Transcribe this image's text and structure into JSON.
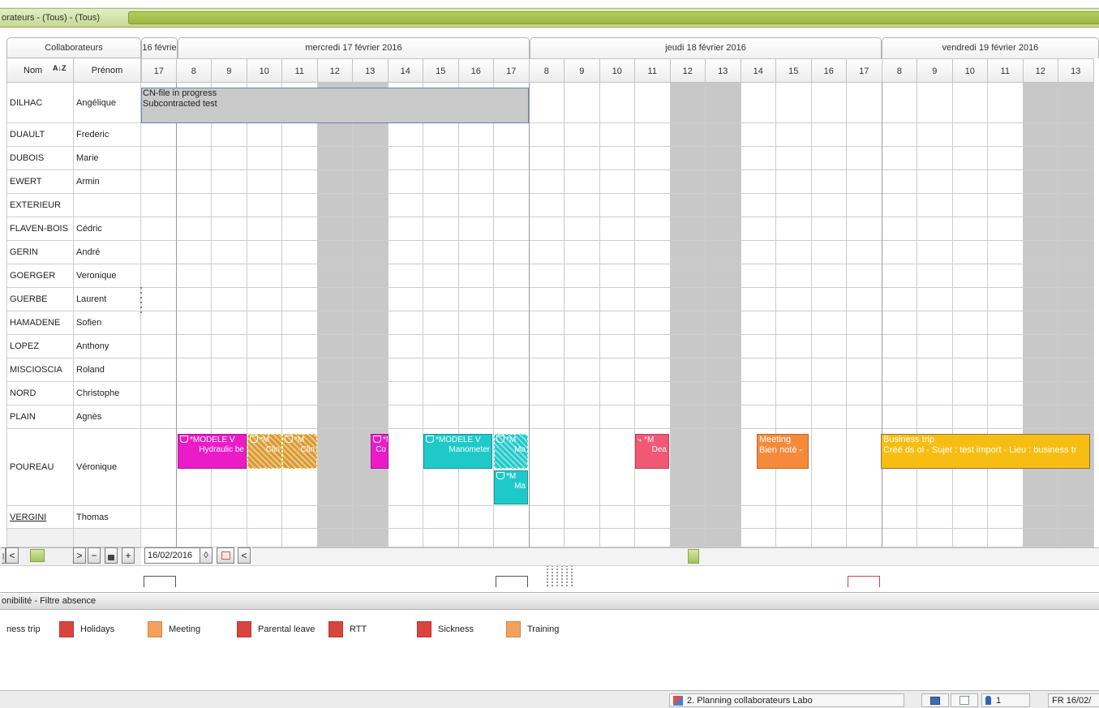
{
  "window": {
    "title": "orateurs - (Tous) - (Tous)"
  },
  "header": {
    "collaborateurs": "Collaborateurs",
    "nom": "Nom",
    "prenom": "Prénom",
    "sort_glyph": "A↓Z",
    "days": [
      "16 févrie",
      "mercredi 17 février 2016",
      "jeudi 18 février 2016",
      "vendredi 19 février 2016"
    ],
    "hours_prev": [
      "17"
    ],
    "hours_wed": [
      "8",
      "9",
      "10",
      "11",
      "12",
      "13",
      "14",
      "15",
      "16",
      "17"
    ],
    "hours_thu": [
      "8",
      "9",
      "10",
      "11",
      "12",
      "13",
      "14",
      "15",
      "16",
      "17"
    ],
    "hours_fri": [
      "8",
      "9",
      "10",
      "11",
      "12",
      "13"
    ]
  },
  "rows": [
    {
      "nom": "DILHAC",
      "prenom": "Angélique"
    },
    {
      "nom": "DUAULT",
      "prenom": "Frederic"
    },
    {
      "nom": "DUBOIS",
      "prenom": "Marie"
    },
    {
      "nom": "EWERT",
      "prenom": "Armin"
    },
    {
      "nom": "EXTERIEUR",
      "prenom": ""
    },
    {
      "nom": "FLAVEN-BOIS",
      "prenom": "Cédric"
    },
    {
      "nom": "GERIN",
      "prenom": "André"
    },
    {
      "nom": "GOERGER",
      "prenom": "Veronique"
    },
    {
      "nom": "GUERBE",
      "prenom": "Laurent"
    },
    {
      "nom": "HAMADENE",
      "prenom": "Sofien"
    },
    {
      "nom": "LOPEZ",
      "prenom": "Anthony"
    },
    {
      "nom": "MISCIOSCIA",
      "prenom": "Roland"
    },
    {
      "nom": "NORD",
      "prenom": "Christophe"
    },
    {
      "nom": "PLAIN",
      "prenom": "Agnès"
    },
    {
      "nom": "POUREAU",
      "prenom": "Véronique"
    },
    {
      "nom": "VERGINI",
      "prenom": "Thomas"
    }
  ],
  "events": {
    "dilhac": {
      "line1": "CN-file in progress",
      "line2": "Subcontracted test"
    },
    "p1": {
      "line1": "*MODELE V",
      "line2": "Hydraulic be"
    },
    "p2": {
      "line1": "*M",
      "line2": "Clin"
    },
    "p3": {
      "line1": "*M",
      "line2": "Clin"
    },
    "p4": {
      "line1": "*M",
      "line2": "Co"
    },
    "p5": {
      "line1": "*MODELE V",
      "line2": "Manometer"
    },
    "p6": {
      "line1": "*M",
      "line2": "Ma"
    },
    "p7": {
      "line1": "*M",
      "line2": "Ma"
    },
    "p8": {
      "line1": "*M",
      "line2": "Dea"
    },
    "p9": {
      "line1": "Meeting",
      "line2": "Bien noté -"
    },
    "p10": {
      "line1": "Business trip",
      "line2": "Créé ds ol - Sujet : test import - Lieu : business tr"
    }
  },
  "navigator": {
    "date": "16/02/2016",
    "spinner_glyph": "◊",
    "prev_glyph": "<",
    "next_glyph": ">",
    "minus_glyph": "−",
    "plus_glyph": "+",
    "lock_glyph": "🔒"
  },
  "section": {
    "title": "onibilité - Filtre absence"
  },
  "legend": [
    {
      "label": "ness trip",
      "color": "#ffffff"
    },
    {
      "label": "Holidays",
      "color": "#d9443f"
    },
    {
      "label": "Meeting",
      "color": "#f4a15d"
    },
    {
      "label": "Parental leave",
      "color": "#d9443f"
    },
    {
      "label": "RTT",
      "color": "#d9443f"
    },
    {
      "label": "Sickness",
      "color": "#d9443f"
    },
    {
      "label": "Training",
      "color": "#f4a15d"
    }
  ],
  "status": {
    "view": "2. Planning collaborateurs Labo",
    "user_count": "1",
    "date": "FR 16/02/"
  },
  "colors": {
    "magenta": "#ea1cc7",
    "ochre": "#d99a2e",
    "cyan": "#20c9c9",
    "pink": "#f05876",
    "orange": "#f58a3a",
    "yellow": "#f8bd12",
    "grey_block": "#c8c8c8"
  }
}
